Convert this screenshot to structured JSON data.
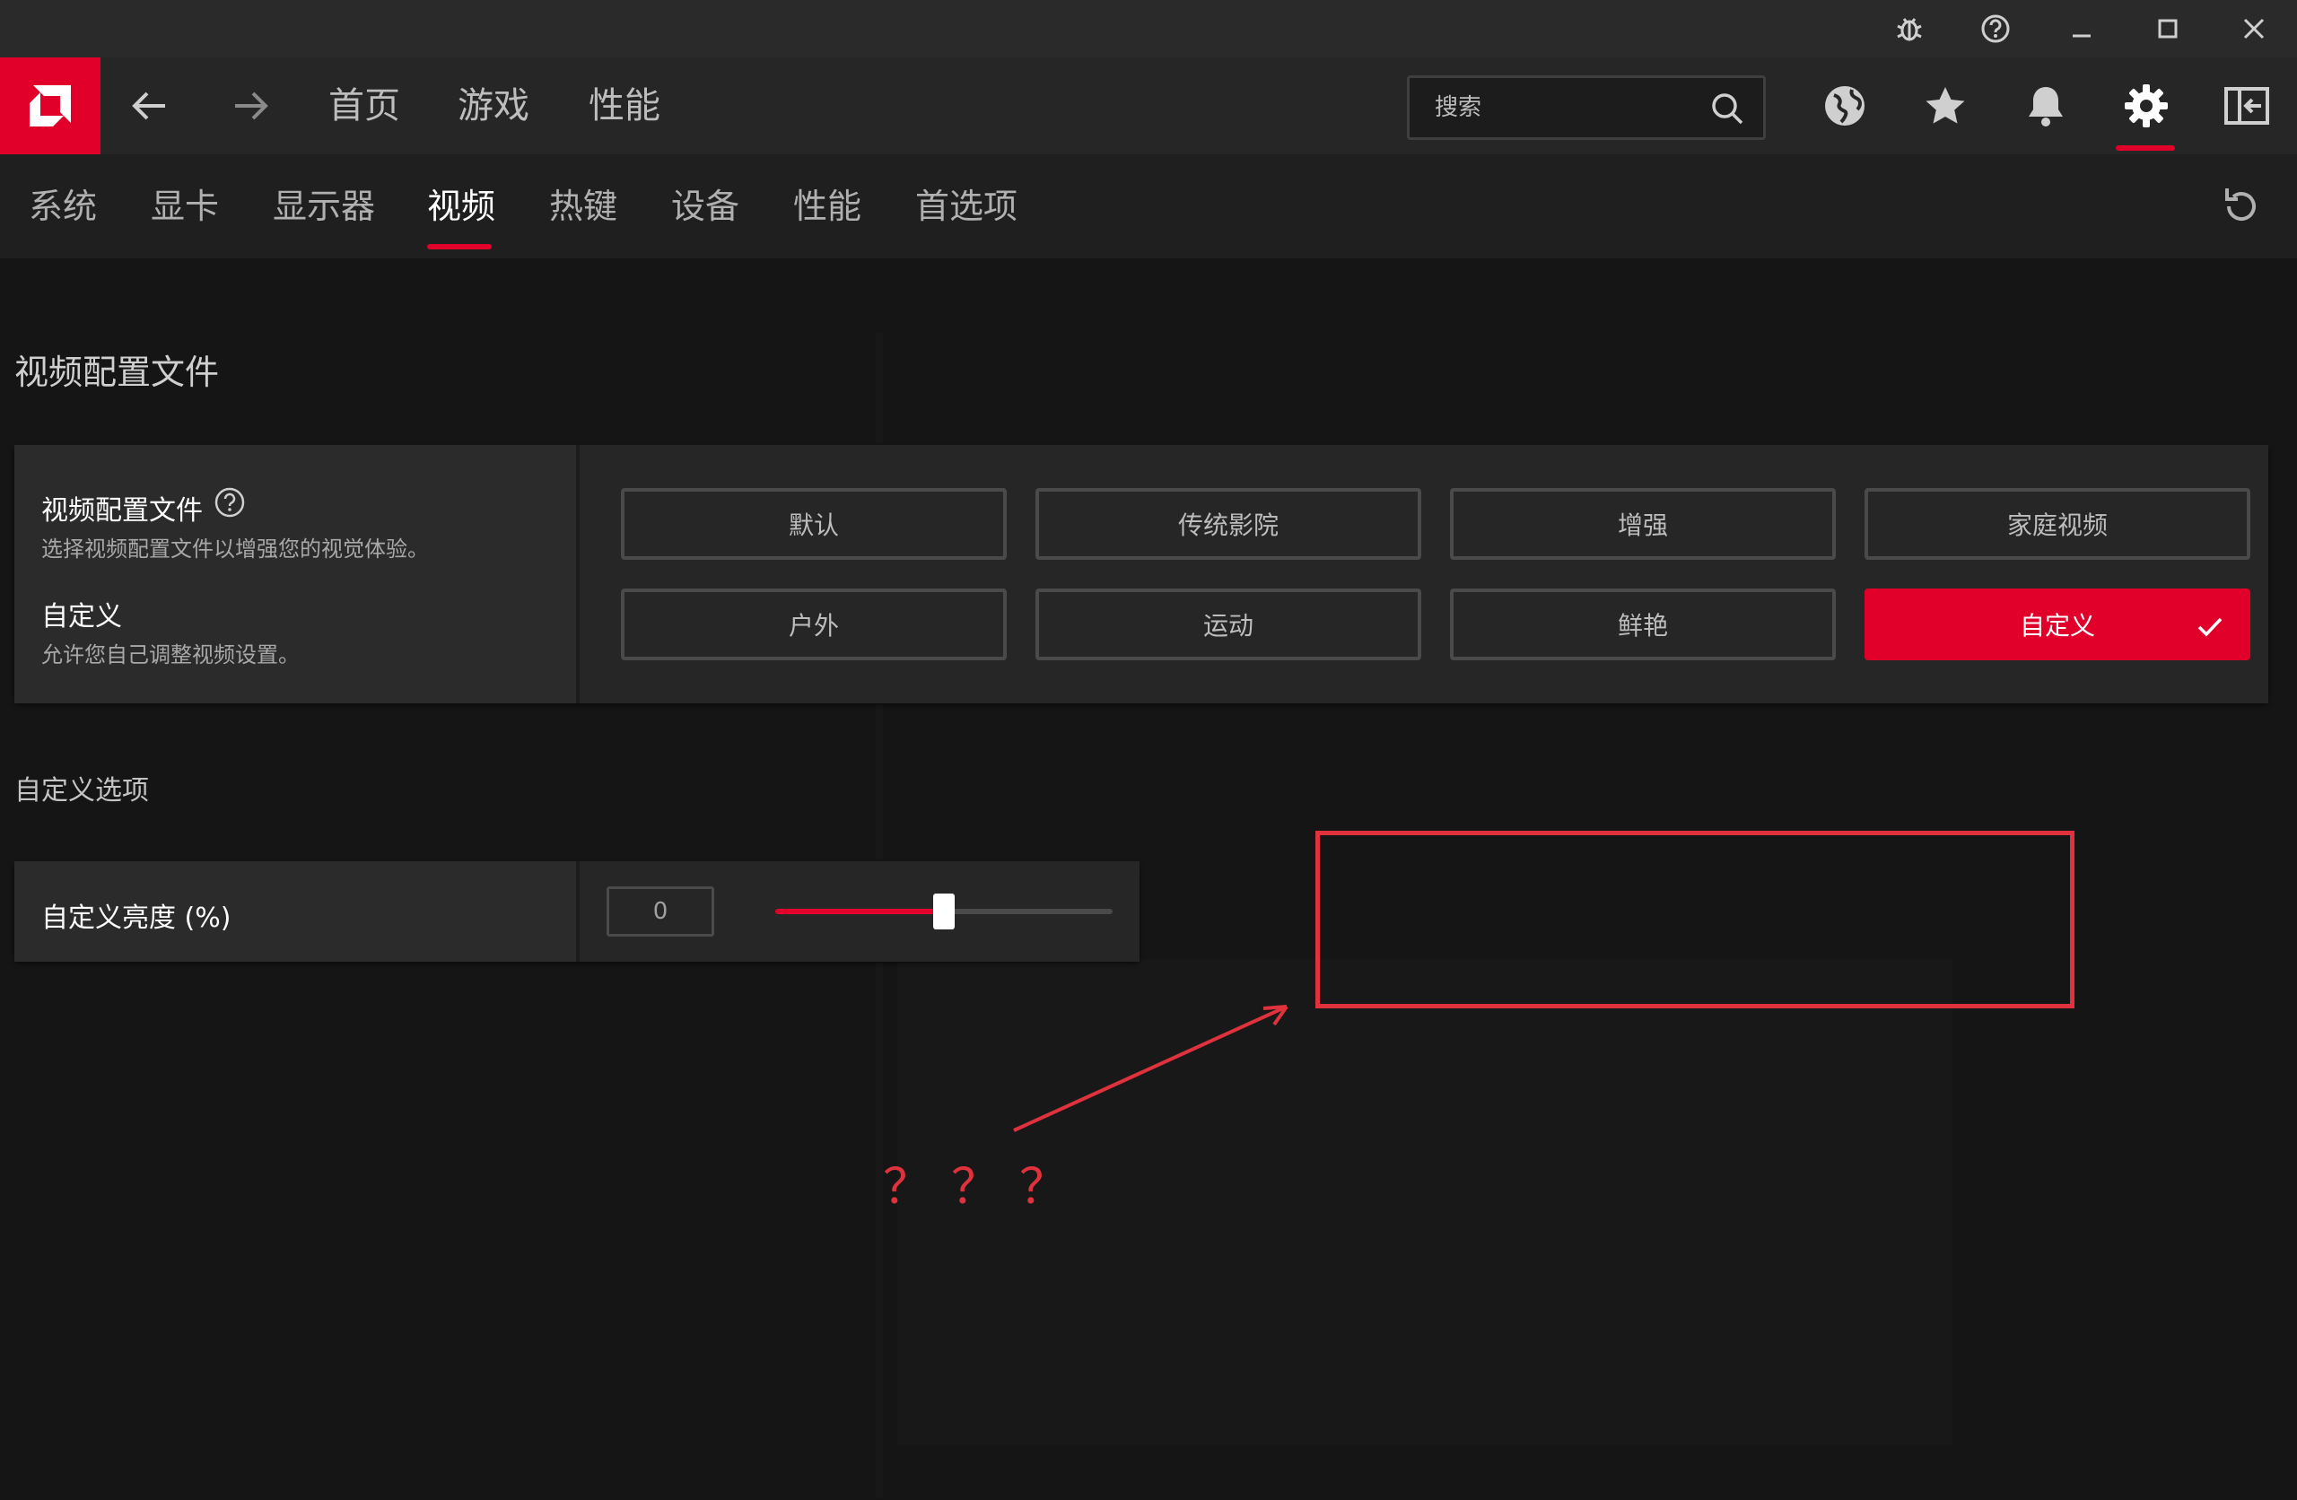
{
  "window": {
    "controls": [
      "bug-icon",
      "help-icon",
      "minimize-icon",
      "maximize-icon",
      "close-icon"
    ]
  },
  "topnav": {
    "links": [
      "首页",
      "游戏",
      "性能"
    ],
    "search": {
      "placeholder": "搜索",
      "value": ""
    },
    "icons": [
      "globe-icon",
      "star-icon",
      "bell-icon",
      "gear-icon",
      "sidebar-toggle-icon"
    ],
    "active_icon": "gear-icon"
  },
  "subnav": {
    "tabs": [
      "系统",
      "显卡",
      "显示器",
      "视频",
      "热键",
      "设备",
      "性能",
      "首选项"
    ],
    "active": "视频"
  },
  "video_profile": {
    "section_title": "视频配置文件",
    "label": "视频配置文件",
    "description": "选择视频配置文件以增强您的视觉体验。",
    "current_label": "自定义",
    "current_description": "允许您自己调整视频设置。",
    "options": [
      "默认",
      "传统影院",
      "增强",
      "家庭视频",
      "户外",
      "运动",
      "鲜艳",
      "自定义"
    ],
    "selected": "自定义"
  },
  "custom_options": {
    "section_title": "自定义选项",
    "brightness_label": "自定义亮度 (%)",
    "brightness_value": "0",
    "slider_fraction": 0.5
  },
  "annotation": {
    "text": "？？？"
  },
  "colors": {
    "accent": "#e0002a",
    "annotation": "#e0323c",
    "background": "#141414"
  }
}
